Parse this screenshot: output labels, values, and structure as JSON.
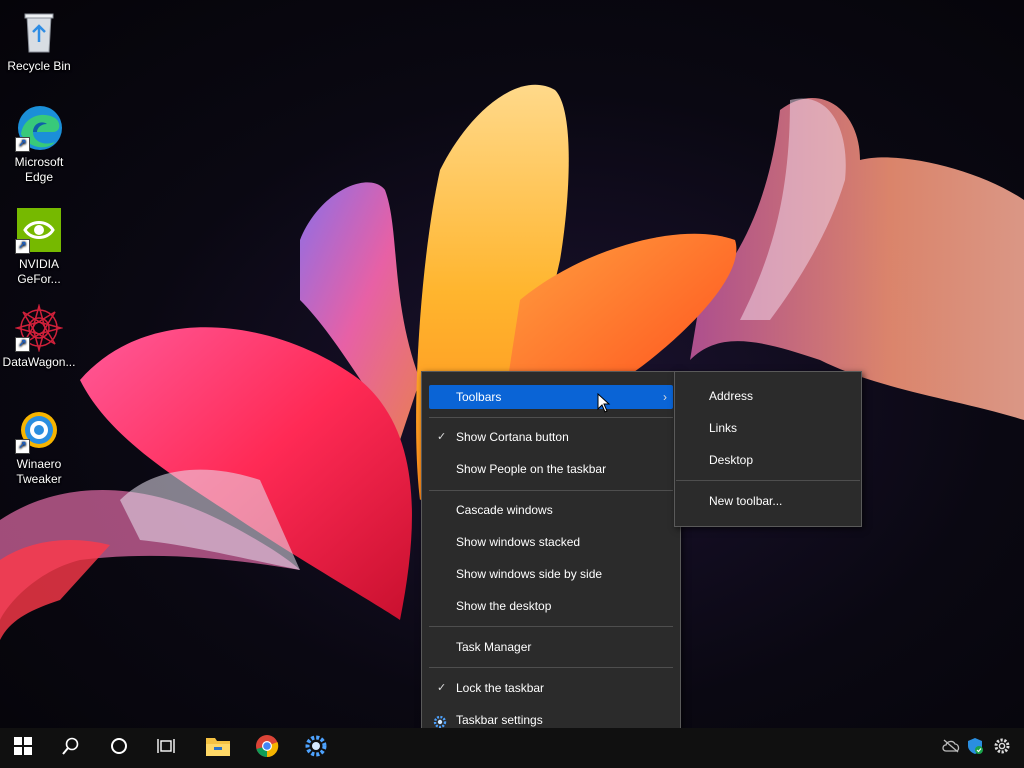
{
  "desktop": {
    "icons": [
      {
        "label": "Recycle Bin",
        "icon": "recycle-bin-icon"
      },
      {
        "label": "Microsoft Edge",
        "icon": "edge-icon",
        "shortcut": true
      },
      {
        "label": "NVIDIA GeFor...",
        "icon": "nvidia-icon",
        "shortcut": true
      },
      {
        "label": "DataWagon...",
        "icon": "datawagon-icon",
        "shortcut": true
      },
      {
        "label": "Winaero Tweaker",
        "icon": "winaero-tweaker-icon",
        "shortcut": true
      }
    ]
  },
  "context_menu": {
    "items": [
      {
        "label": "Toolbars",
        "highlighted": true,
        "has_submenu": true
      },
      {
        "label": "Show Cortana button",
        "checked": true
      },
      {
        "label": "Show People on the taskbar"
      },
      {
        "label": "Cascade windows"
      },
      {
        "label": "Show windows stacked"
      },
      {
        "label": "Show windows side by side"
      },
      {
        "label": "Show the desktop"
      },
      {
        "label": "Task Manager"
      },
      {
        "label": "Lock the taskbar",
        "checked": true
      },
      {
        "label": "Taskbar settings",
        "icon": "gear-icon"
      }
    ],
    "check_glyph": "✓",
    "arrow_glyph": "›"
  },
  "submenu": {
    "items": [
      {
        "label": "Address"
      },
      {
        "label": "Links"
      },
      {
        "label": "Desktop"
      },
      {
        "label": "New toolbar..."
      }
    ]
  },
  "taskbar": {
    "buttons": [
      "start-icon",
      "search-icon",
      "cortana-icon",
      "task-view-icon",
      "file-explorer-icon",
      "chrome-icon",
      "settings-app-icon"
    ],
    "tray": [
      "onedrive-icon",
      "defender-icon",
      "gear-icon"
    ]
  },
  "colors": {
    "highlight": "#0a64d6",
    "menu_bg": "#2b2b2b",
    "taskbar_bg": "#101010"
  }
}
